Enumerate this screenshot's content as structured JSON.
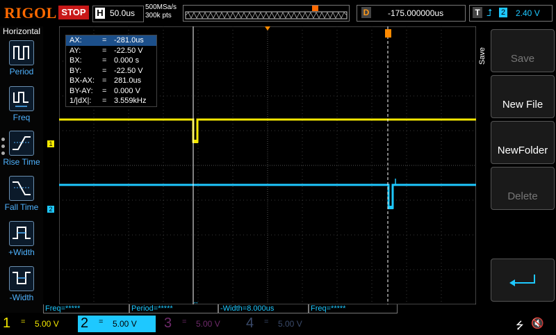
{
  "header": {
    "brand": "RIGOL",
    "run_status": "STOP",
    "timebase": {
      "label": "H",
      "value": "50.0us"
    },
    "sample": {
      "rate": "500MSa/s",
      "points": "300k pts"
    },
    "delay": {
      "label": "D",
      "value": "-175.000000us"
    },
    "trigger": {
      "label": "T",
      "edge_icon": "rising-edge-icon",
      "source": "2",
      "level": "2.40 V"
    }
  },
  "left_menu": {
    "title": "Horizontal",
    "items": [
      {
        "label": "Period",
        "icon": "period-icon"
      },
      {
        "label": "Freq",
        "icon": "freq-icon"
      },
      {
        "label": "Rise Time",
        "icon": "rise-time-icon"
      },
      {
        "label": "Fall Time",
        "icon": "fall-time-icon"
      },
      {
        "label": "+Width",
        "icon": "pos-width-icon"
      },
      {
        "label": "-Width",
        "icon": "neg-width-icon"
      }
    ]
  },
  "cursor_table": [
    {
      "key": "AX:",
      "value": "-281.0us"
    },
    {
      "key": "AY:",
      "value": "-22.50 V"
    },
    {
      "key": "BX:",
      "value": "0.000 s"
    },
    {
      "key": "BY:",
      "value": "-22.50 V"
    },
    {
      "key": "BX-AX:",
      "value": "281.0us"
    },
    {
      "key": "BY-AY:",
      "value": "0.000 V"
    },
    {
      "key": "1/|dX|:",
      "value": "3.559kHz"
    }
  ],
  "cursor_eq": "=",
  "channel_markers": {
    "ch1": "1",
    "ch2": "2",
    "trigger": "T"
  },
  "right_menu": {
    "title": "Save",
    "buttons": [
      {
        "label": "Save",
        "enabled": false
      },
      {
        "label": "New File",
        "enabled": true
      },
      {
        "label": "NewFolder",
        "enabled": true
      },
      {
        "label": "Delete",
        "enabled": false
      },
      {
        "label": "",
        "icon": "return-icon",
        "enabled": true
      }
    ]
  },
  "measurements": [
    {
      "label": "Freq=*****"
    },
    {
      "label": "Period=*****"
    },
    {
      "label": "-Width=8.000us"
    },
    {
      "label": "Freq=*****"
    }
  ],
  "channels": [
    {
      "num": "1",
      "coupling": "=",
      "scale": "5.00 V",
      "color": "#f4e800",
      "active": false
    },
    {
      "num": "2",
      "coupling": "=",
      "scale": "5.00 V",
      "color": "#1ec8ff",
      "active": true
    },
    {
      "num": "3",
      "coupling": "=",
      "scale": "5.00 V",
      "color": "#6e2a6a",
      "active": false
    },
    {
      "num": "4",
      "coupling": "=",
      "scale": "5.00 V",
      "color": "#3a4a6a",
      "active": false
    }
  ],
  "status_icons": [
    "usb-icon",
    "speaker-mute-icon"
  ],
  "colors": {
    "ch1": "#f4e800",
    "ch2": "#1ec8ff",
    "brand": "#ff6a00",
    "stop": "#c81818",
    "trigger": "#ff9a1a"
  }
}
